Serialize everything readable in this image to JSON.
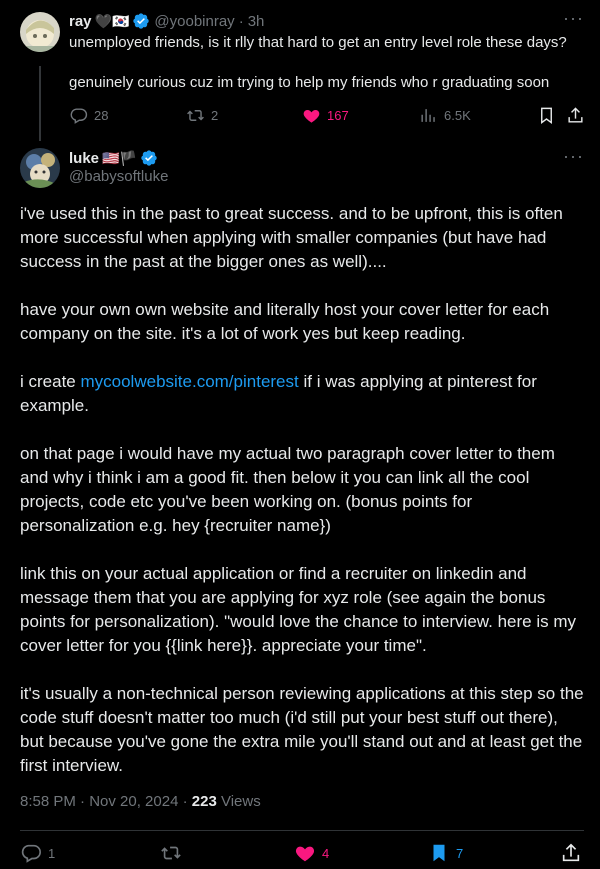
{
  "parent_tweet": {
    "name": "ray",
    "emoji": "🖤🇰🇷",
    "handle": "@yoobinray",
    "separator": "·",
    "time": "3h",
    "text_line1": "unemployed friends, is it rlly that hard to get an entry level role these days?",
    "text_line2": "genuinely curious cuz im trying to help my friends who r graduating soon",
    "replies": "28",
    "reposts": "2",
    "likes": "167",
    "views": "6.5K"
  },
  "main_tweet": {
    "name": "luke",
    "emoji": "🇺🇸🏴",
    "handle": "@babysoftluke",
    "p1": "i've used this in the past to great success. and to be upfront, this is often more successful when applying with smaller companies (but have had success in the past at the bigger ones as well)....",
    "p2": "have your own own website and literally host your cover letter for each company on the site. it's a lot of work yes but keep reading.",
    "p3_before": "i create ",
    "p3_link": "mycoolwebsite.com/pinterest",
    "p3_after": " if i was applying at pinterest for example.",
    "p4": "on that page i would have my actual two paragraph cover letter to them and why i think i am a good fit. then below it you can link all the cool projects, code etc you've been working on. (bonus points for personalization e.g. hey {recruiter name})",
    "p5": "link this on your actual application or find a recruiter on linkedin and message them that you are applying for xyz role (see again the bonus points for personalization). \"would love the chance to interview. here is my cover letter for you {{link here}}. appreciate your time\".",
    "p6": "it's usually a non-technical person reviewing applications at this step so the code stuff doesn't matter too much (i'd still put your best stuff out there), but because you've gone the extra mile you'll stand out and at least get the first interview.",
    "timestamp": "8:58 PM · Nov 20, 2024 · ",
    "views_count": "223",
    "views_label": " Views",
    "replies": "1",
    "likes": "4",
    "bookmarks": "7"
  },
  "colors": {
    "background": "#000000",
    "text": "#e7e9ea",
    "muted": "#71767b",
    "link": "#1d9bf0",
    "like": "#f91880"
  }
}
